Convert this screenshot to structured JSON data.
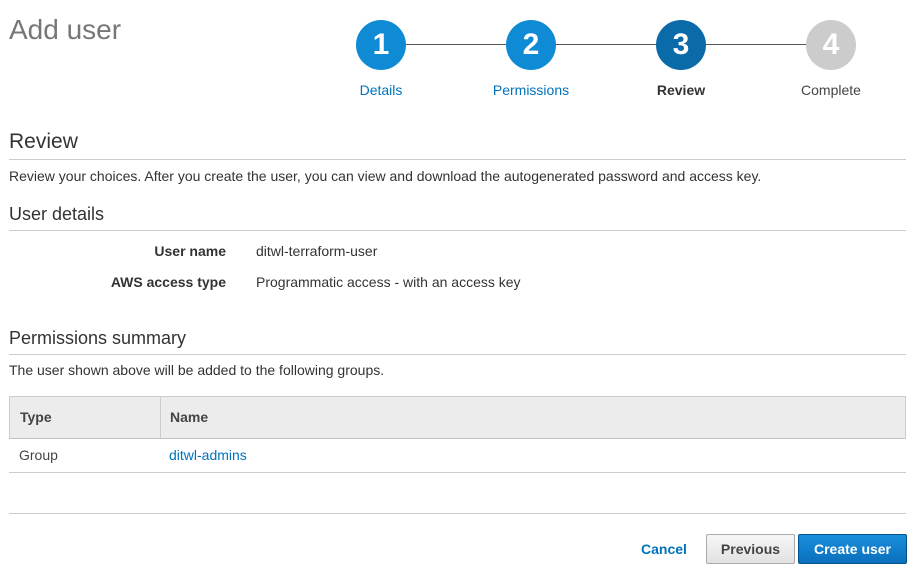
{
  "page_title": "Add user",
  "wizard": {
    "steps": [
      {
        "number": "1",
        "label": "Details",
        "state": "completed"
      },
      {
        "number": "2",
        "label": "Permissions",
        "state": "completed"
      },
      {
        "number": "3",
        "label": "Review",
        "state": "current"
      },
      {
        "number": "4",
        "label": "Complete",
        "state": "pending"
      }
    ]
  },
  "review": {
    "heading": "Review",
    "description": "Review your choices. After you create the user, you can view and download the autogenerated password and access key."
  },
  "user_details": {
    "heading": "User details",
    "fields": [
      {
        "label": "User name",
        "value": "ditwl-terraform-user"
      },
      {
        "label": "AWS access type",
        "value": "Programmatic access - with an access key"
      }
    ]
  },
  "permissions_summary": {
    "heading": "Permissions summary",
    "description": "The user shown above will be added to the following groups.",
    "table": {
      "columns": [
        "Type",
        "Name"
      ],
      "rows": [
        {
          "type": "Group",
          "name": "ditwl-admins"
        }
      ]
    }
  },
  "footer": {
    "cancel_label": "Cancel",
    "previous_label": "Previous",
    "create_label": "Create user"
  },
  "colors": {
    "step_completed": "#0f8ad4",
    "step_current": "#0b6aa8",
    "step_pending": "#cccccc",
    "link": "#0073bb",
    "primary_button": "#0a6fbc"
  }
}
